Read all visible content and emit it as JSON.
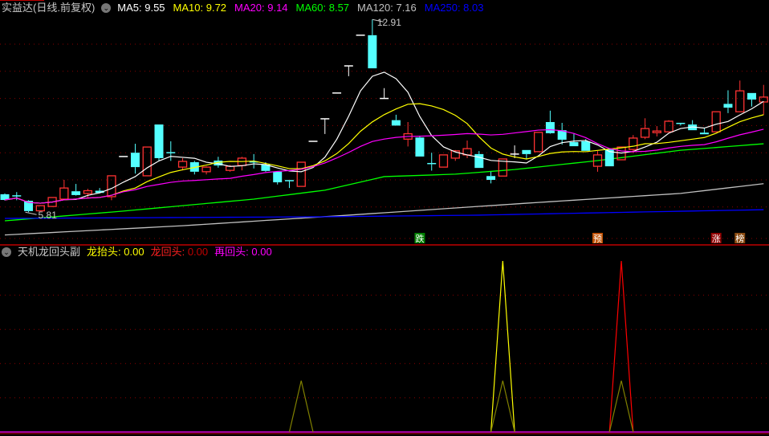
{
  "main_header": {
    "title": "实益达(日线.前复权)",
    "indicators": [
      {
        "label": "MA5: 9.55",
        "color": "#ffffff"
      },
      {
        "label": "MA10: 9.72",
        "color": "#ffff00"
      },
      {
        "label": "MA20: 9.14",
        "color": "#ff00ff"
      },
      {
        "label": "MA60: 8.57",
        "color": "#00ff00"
      },
      {
        "label": "MA120: 7.16",
        "color": "#c0c0c0"
      },
      {
        "label": "MA250: 8.03",
        "color": "#0000ff"
      }
    ]
  },
  "sub_header": {
    "title": "天机龙回头副",
    "items": [
      {
        "name": "龙抬头",
        "value": "0.00",
        "color": "#ffff00",
        "value_color": "#ffff00"
      },
      {
        "name": "龙回头",
        "value": "0.00",
        "color": "#ff2020",
        "value_color": "#c00000"
      },
      {
        "name": "再回头",
        "value": "0.00",
        "color": "#ff00ff",
        "value_color": "#ff00ff"
      }
    ]
  },
  "chart_data": [
    {
      "type": "candlestick",
      "title": "实益达(日线.前复权)",
      "ylim": [
        4.8,
        13.0
      ],
      "gridlines": [
        6,
        7,
        8,
        9,
        10,
        11,
        12
      ],
      "colors": {
        "up": "#ff3232",
        "down": "#54ffff",
        "flat": "#ffffff"
      },
      "high_label": {
        "text": "12.91",
        "index": 31
      },
      "low_label": {
        "text": "5.81",
        "index": 2
      },
      "ohlc": [
        [
          6.47,
          6.5,
          6.24,
          6.26
        ],
        [
          6.41,
          6.55,
          6.25,
          6.4
        ],
        [
          6.23,
          6.25,
          5.81,
          5.85
        ],
        [
          5.86,
          6.07,
          5.84,
          6.05
        ],
        [
          6.02,
          6.36,
          6.0,
          6.35
        ],
        [
          6.29,
          7.0,
          6.27,
          6.7
        ],
        [
          6.58,
          6.85,
          6.42,
          6.44
        ],
        [
          6.5,
          6.67,
          6.35,
          6.6
        ],
        [
          6.6,
          6.7,
          6.5,
          6.52
        ],
        [
          6.38,
          7.15,
          6.25,
          7.15
        ],
        [
          7.86,
          7.86,
          7.86,
          7.86
        ],
        [
          8.0,
          8.33,
          7.23,
          7.47
        ],
        [
          7.15,
          8.21,
          7.15,
          8.21
        ],
        [
          9.04,
          9.04,
          7.7,
          7.8
        ],
        [
          8.0,
          8.42,
          7.7,
          7.99
        ],
        [
          7.47,
          7.8,
          7.35,
          7.68
        ],
        [
          7.65,
          7.7,
          7.2,
          7.3
        ],
        [
          7.3,
          7.5,
          7.2,
          7.47
        ],
        [
          7.71,
          7.85,
          7.45,
          7.53
        ],
        [
          7.35,
          7.55,
          7.3,
          7.5
        ],
        [
          7.53,
          7.85,
          7.35,
          7.8
        ],
        [
          7.66,
          7.95,
          7.42,
          7.65
        ],
        [
          7.56,
          7.65,
          7.3,
          7.33
        ],
        [
          7.3,
          7.3,
          6.83,
          6.91
        ],
        [
          6.97,
          6.97,
          6.7,
          6.96
        ],
        [
          6.76,
          7.65,
          6.76,
          7.65
        ],
        [
          8.42,
          8.42,
          8.42,
          8.42
        ],
        [
          9.25,
          9.25,
          8.69,
          9.25
        ],
        [
          10.2,
          10.2,
          10.2,
          10.2
        ],
        [
          11.2,
          11.2,
          10.82,
          11.2
        ],
        [
          12.33,
          12.33,
          12.33,
          12.33
        ],
        [
          12.33,
          12.91,
          11.11,
          11.11
        ],
        [
          10.0,
          10.38,
          10.0,
          10.0
        ],
        [
          9.2,
          9.4,
          9.0,
          9.0
        ],
        [
          8.5,
          9.13,
          8.23,
          8.7
        ],
        [
          8.56,
          8.63,
          7.86,
          7.86
        ],
        [
          7.6,
          8.0,
          7.34,
          7.59
        ],
        [
          7.47,
          7.92,
          7.47,
          7.92
        ],
        [
          7.8,
          8.1,
          7.7,
          8.07
        ],
        [
          7.92,
          8.45,
          7.8,
          8.15
        ],
        [
          7.95,
          8.06,
          7.44,
          7.44
        ],
        [
          7.14,
          7.3,
          6.87,
          7.0
        ],
        [
          7.14,
          7.77,
          7.14,
          7.77
        ],
        [
          7.95,
          8.27,
          7.8,
          7.95
        ],
        [
          8.1,
          8.1,
          7.75,
          7.95
        ],
        [
          8.04,
          8.75,
          8.04,
          8.75
        ],
        [
          9.13,
          9.55,
          8.7,
          8.72
        ],
        [
          8.83,
          9.1,
          8.3,
          8.48
        ],
        [
          8.39,
          8.71,
          8.24,
          8.24
        ],
        [
          8.42,
          8.5,
          8.07,
          8.07
        ],
        [
          7.5,
          8.06,
          7.3,
          7.92
        ],
        [
          8.12,
          8.12,
          7.5,
          7.5
        ],
        [
          7.74,
          8.21,
          7.74,
          8.21
        ],
        [
          8.12,
          8.65,
          7.98,
          8.54
        ],
        [
          8.57,
          9.27,
          8.5,
          8.89
        ],
        [
          8.74,
          8.98,
          8.6,
          8.8
        ],
        [
          8.77,
          9.2,
          8.77,
          9.16
        ],
        [
          9.08,
          9.1,
          9.0,
          9.07
        ],
        [
          9.04,
          9.2,
          8.83,
          8.83
        ],
        [
          8.74,
          8.9,
          8.68,
          8.68
        ],
        [
          8.77,
          9.51,
          8.77,
          9.51
        ],
        [
          9.8,
          10.3,
          9.46,
          9.66
        ],
        [
          9.51,
          10.66,
          9.51,
          10.28
        ],
        [
          10.2,
          10.2,
          9.7,
          9.96
        ],
        [
          9.87,
          10.5,
          9.4,
          10.05
        ]
      ],
      "moving_averages": [
        {
          "name": "MA5",
          "period": 5,
          "color": "#ffffff"
        },
        {
          "name": "MA10",
          "period": 10,
          "color": "#ffff00"
        },
        {
          "name": "MA20",
          "period": 20,
          "color": "#ff00ff"
        }
      ],
      "long_averages": [
        {
          "name": "MA60",
          "color": "#00ff00",
          "points": [
            [
              0,
              5.49
            ],
            [
              10,
              5.85
            ],
            [
              21,
              6.29
            ],
            [
              27,
              6.62
            ],
            [
              32,
              7.12
            ],
            [
              38,
              7.21
            ],
            [
              43,
              7.38
            ],
            [
              50,
              7.71
            ],
            [
              57,
              8.09
            ],
            [
              64,
              8.33
            ]
          ]
        },
        {
          "name": "MA120",
          "color": "#c0c0c0",
          "points": [
            [
              0,
              4.97
            ],
            [
              15,
              5.31
            ],
            [
              29,
              5.7
            ],
            [
              44,
              6.14
            ],
            [
              57,
              6.5
            ],
            [
              64,
              6.86
            ]
          ]
        },
        {
          "name": "MA250",
          "color": "#0000ff",
          "points": [
            [
              0,
              5.58
            ],
            [
              27,
              5.64
            ],
            [
              40,
              5.7
            ],
            [
              54,
              5.82
            ],
            [
              64,
              5.9
            ]
          ]
        }
      ],
      "signal_markers": [
        {
          "text": "跌",
          "index": 35,
          "color": "#008000"
        },
        {
          "text": "预",
          "index": 50,
          "color": "#c05000"
        },
        {
          "text": "涨",
          "index": 60,
          "color": "#900000"
        },
        {
          "text": "榜",
          "index": 62,
          "color": "#8a4a10"
        }
      ]
    },
    {
      "type": "line",
      "title": "天机龙回头副",
      "ylim": [
        0,
        100
      ],
      "gridlines": [
        20,
        40,
        60,
        80
      ],
      "series": [
        {
          "name": "龙抬头",
          "color": "#ffff00",
          "spikes": [
            [
              42,
              100
            ]
          ]
        },
        {
          "name": "龙回头",
          "color": "#ff0000",
          "spikes": [
            [
              52,
              100
            ]
          ]
        },
        {
          "name": "signal-base",
          "color": "#808000",
          "spikes": [
            [
              25,
              30
            ],
            [
              42,
              30
            ],
            [
              52,
              30
            ]
          ]
        },
        {
          "name": "再回头",
          "color": "#ff00ff",
          "spikes": []
        }
      ]
    }
  ]
}
